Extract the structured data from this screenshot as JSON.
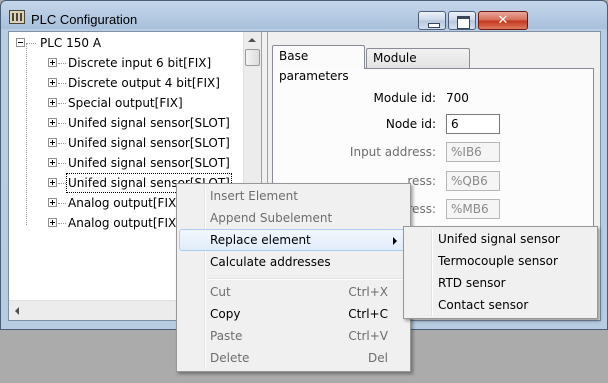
{
  "window": {
    "title": "PLC Configuration",
    "icon": "plc-config-icon"
  },
  "tree": {
    "root": "PLC 150 A",
    "items": [
      {
        "label": "Discrete input 6 bit[FIX]"
      },
      {
        "label": "Discrete output 4 bit[FIX]"
      },
      {
        "label": "Special output[FIX]"
      },
      {
        "label": "Unifed signal sensor[SLOT]"
      },
      {
        "label": "Unifed signal sensor[SLOT]"
      },
      {
        "label": "Unifed signal sensor[SLOT]"
      },
      {
        "label": "Unifed signal sensor[SLOT]",
        "selected": true
      },
      {
        "label": "Analog output[FIX]"
      },
      {
        "label": "Analog output[FIX]"
      }
    ]
  },
  "tabs": [
    {
      "label": "Base parameters",
      "active": true
    },
    {
      "label": "Module parameters",
      "active": false
    }
  ],
  "params": {
    "module_id_label": "Module id:",
    "module_id_value": "700",
    "node_id_label": "Node id:",
    "node_id_value": "6",
    "input_address_label": "Input address:",
    "input_address_value": "%IB6",
    "output_address_label_visible": "ress:",
    "output_address_value": "%QB6",
    "diag_address_label_visible": "ress:",
    "diag_address_value": "%MB6"
  },
  "context_menu": {
    "items": [
      {
        "label": "Insert Element",
        "shortcut": "",
        "enabled": false
      },
      {
        "label": "Append Subelement",
        "shortcut": "",
        "enabled": false
      },
      {
        "label": "Replace element",
        "shortcut": "",
        "enabled": true,
        "submenu": true,
        "highlighted": true
      },
      {
        "label": "Calculate addresses",
        "shortcut": "",
        "enabled": true
      },
      {
        "label": "Cut",
        "shortcut": "Ctrl+X",
        "enabled": false
      },
      {
        "label": "Copy",
        "shortcut": "Ctrl+C",
        "enabled": true
      },
      {
        "label": "Paste",
        "shortcut": "Ctrl+V",
        "enabled": false
      },
      {
        "label": "Delete",
        "shortcut": "Del",
        "enabled": false
      }
    ]
  },
  "submenu": {
    "items": [
      {
        "label": "Unifed signal sensor"
      },
      {
        "label": "Termocouple sensor"
      },
      {
        "label": "RTD sensor"
      },
      {
        "label": "Contact sensor"
      }
    ]
  },
  "colors": {
    "desktop": "#ababab",
    "menu_highlight": "#e1ecfa",
    "disabled_text": "#6d6d6d"
  }
}
